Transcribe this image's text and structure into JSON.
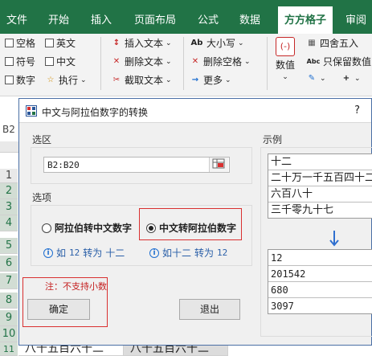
{
  "ribbon_tabs": [
    "文件",
    "开始",
    "插入",
    "页面布局",
    "公式",
    "数据",
    "方方格子",
    "审阅"
  ],
  "ribbon": {
    "checkboxes": [
      "空格",
      "英文",
      "符号",
      "中文",
      "数字"
    ],
    "execute": "执行",
    "insert_text": "插入文本",
    "delete_text": "删除文本",
    "extract_text": "截取文本",
    "case_label": "大小写",
    "delete_spaces": "删除空格",
    "more": "更多",
    "value_label": "数值",
    "rounding": "四舍五入",
    "keep_value": "只保留数值",
    "ab_icon": "Ab",
    "abc_icon": "Abc"
  },
  "sheet": {
    "name_box": "B2",
    "rows": [
      "1",
      "2",
      "3",
      "4",
      "5",
      "6",
      "7",
      "8",
      "9",
      "10",
      "11"
    ],
    "bottom_cells": [
      "八千五百六十二",
      "八千五百六十二"
    ]
  },
  "dialog": {
    "title": "中文与阿拉伯数字的转换",
    "help": "?",
    "range_label": "选区",
    "range_value": "B2:B20",
    "options_label": "选项",
    "option_arabic_to_chinese": "阿拉伯转中文数字",
    "option_chinese_to_arabic": "中文转阿拉伯数字",
    "selected_option": "chinese_to_arabic",
    "hint_a": {
      "prefix": "如",
      "from": "12",
      "mid": "转为",
      "to": "十二"
    },
    "hint_b": {
      "prefix": "如十二",
      "mid": "转为",
      "to": "12"
    },
    "note": "注：不支持小数",
    "ok_button": "确定",
    "exit_button": "退出",
    "example_label": "示例",
    "example_chinese": [
      "十二",
      "二十万一千五百四十二",
      "六百八十",
      "三千零九十七"
    ],
    "example_arabic": [
      "12",
      "201542",
      "680",
      "3097"
    ]
  },
  "colors": {
    "accent": "#217346",
    "highlight": "#d93030",
    "hint": "#2a5fa8"
  }
}
